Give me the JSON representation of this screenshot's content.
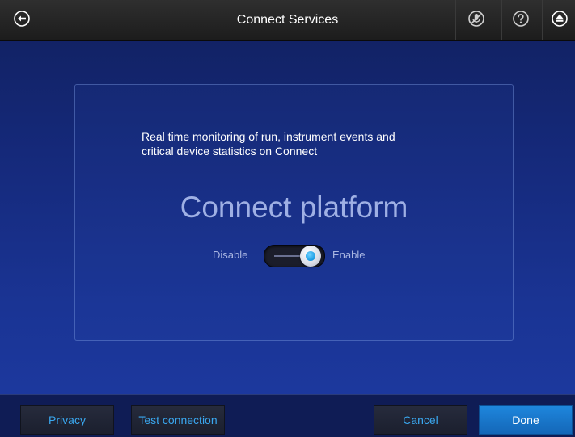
{
  "header": {
    "title": "Connect Services",
    "icons": {
      "back": "back-arrow-icon",
      "mute": "mute-microphone-icon",
      "help": "help-icon",
      "eject": "eject-icon"
    }
  },
  "panel": {
    "description_line1": "Real time monitoring of run, instrument events and",
    "description_line2": "critical device statistics on Connect",
    "headline": "Connect platform",
    "toggle": {
      "off_label": "Disable",
      "on_label": "Enable",
      "state": "enabled"
    }
  },
  "footer": {
    "privacy_label": "Privacy",
    "test_connection_label": "Test connection",
    "cancel_label": "Cancel",
    "done_label": "Done"
  },
  "colors": {
    "accent": "#3aa8f0",
    "primary_button": "#1a78cc",
    "background_top": "#11205e",
    "background_bottom": "#1d3aa2"
  }
}
